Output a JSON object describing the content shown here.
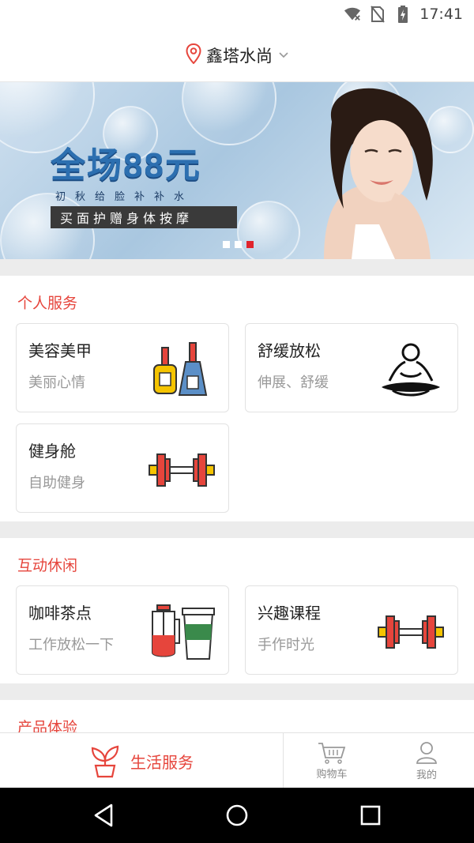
{
  "status_bar": {
    "time": "17:41",
    "icons": [
      "wifi-off-icon",
      "no-sim-icon",
      "battery-charging-icon"
    ]
  },
  "header": {
    "location": "鑫塔水尚",
    "location_icon": "map-pin-icon",
    "dropdown_icon": "chevron-down-icon"
  },
  "banner": {
    "headline": "全场88元",
    "subline": "初秋给脸补补水",
    "offer": "买面护赠身体按摩",
    "page_count": 3,
    "active_page": 3
  },
  "sections": [
    {
      "title": "个人服务",
      "cards": [
        {
          "title": "美容美甲",
          "subtitle": "美丽心情",
          "icon": "nail-polish-icon"
        },
        {
          "title": "舒缓放松",
          "subtitle": "伸展、舒缓",
          "icon": "meditation-icon"
        },
        {
          "title": "健身舱",
          "subtitle": "自助健身",
          "icon": "dumbbell-icon"
        }
      ]
    },
    {
      "title": "互动休闲",
      "cards": [
        {
          "title": "咖啡茶点",
          "subtitle": "工作放松一下",
          "icon": "coffee-drinks-icon"
        },
        {
          "title": "兴趣课程",
          "subtitle": "手作时光",
          "icon": "dumbbell-icon"
        }
      ]
    },
    {
      "title": "产品体验",
      "cards": []
    }
  ],
  "tab_bar": {
    "items": [
      {
        "label": "生活服务",
        "icon": "plant-pot-icon",
        "active": true
      },
      {
        "label": "购物车",
        "icon": "shopping-cart-icon",
        "active": false
      },
      {
        "label": "我的",
        "icon": "user-icon",
        "active": false
      }
    ]
  },
  "colors": {
    "accent": "#e6453c",
    "banner_headline": "#2c6fb0",
    "active_dot": "#e0242c"
  },
  "nav_bar": {
    "buttons": [
      "back-icon",
      "home-icon",
      "recents-icon"
    ]
  }
}
